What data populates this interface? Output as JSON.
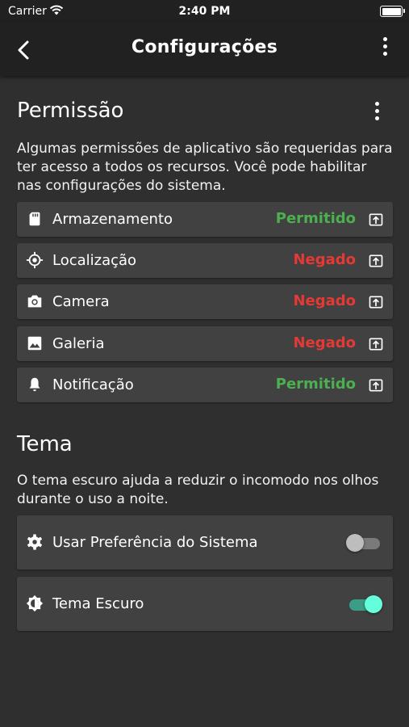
{
  "status_bar": {
    "carrier": "Carrier",
    "time": "2:40 PM"
  },
  "app_bar": {
    "title": "Configurações"
  },
  "permissions": {
    "title": "Permissão",
    "description": "Algumas permissões de aplicativo são requeridas para ter acesso a todos os recursos. Você pode habilitar nas configurações do sistema.",
    "items": [
      {
        "label": "Armazenamento",
        "status": "Permitido",
        "icon": "sd-card-icon"
      },
      {
        "label": "Localização",
        "status": "Negado",
        "icon": "location-target-icon"
      },
      {
        "label": "Camera",
        "status": "Negado",
        "icon": "camera-icon"
      },
      {
        "label": "Galeria",
        "status": "Negado",
        "icon": "image-icon"
      },
      {
        "label": "Notificação",
        "status": "Permitido",
        "icon": "bell-icon"
      }
    ]
  },
  "theme": {
    "title": "Tema",
    "description": "O tema escuro ajuda a reduzir o incomodo nos olhos durante o uso a noite.",
    "items": [
      {
        "label": "Usar Preferência do Sistema",
        "enabled": false,
        "icon": "gear-icon"
      },
      {
        "label": "Tema Escuro",
        "enabled": true,
        "icon": "brightness-icon"
      }
    ]
  },
  "colors": {
    "background": "#2f2f2f",
    "app_bar": "#212121",
    "card": "#414141",
    "granted": "#4caf50",
    "denied": "#e53935",
    "switch_on": "#64ffda"
  }
}
